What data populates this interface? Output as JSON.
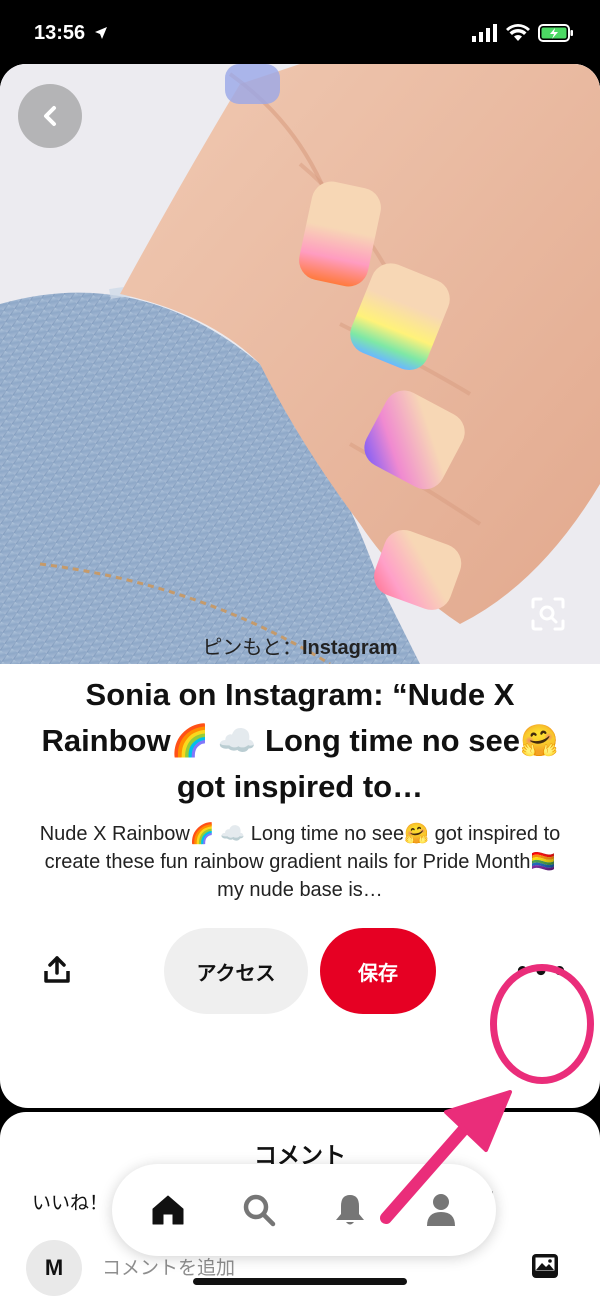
{
  "status_bar": {
    "time": "13:56",
    "icons": [
      "location-arrow-icon",
      "signal-icon",
      "wifi-icon",
      "battery-charging-icon"
    ]
  },
  "pin": {
    "source_prefix": "ピンもと：",
    "source_name": "Instagram",
    "title": "Sonia on Instagram: “Nude X Rainbow🌈 ☁️ Long time no see🤗 got inspired to…",
    "description": "Nude X Rainbow🌈 ☁️ Long time no see🤗 got inspired to create these fun rainbow gradient nails for Pride Month🏳️‍🌈 my nude base is…",
    "image_icon": "nail-photo"
  },
  "actions": {
    "share_icon": "share-icon",
    "visit_label": "アクセス",
    "save_label": "保存",
    "more_label": "•••"
  },
  "comments": {
    "title": "コメント",
    "like_text": "いいね！",
    "like_end": "!",
    "avatar_initial": "M",
    "input_placeholder": "コメントを追加"
  },
  "tabbar": {
    "items": [
      "home-icon",
      "search-icon",
      "bell-icon",
      "profile-icon"
    ]
  },
  "colors": {
    "accent_red": "#e60023",
    "annotation_pink": "#ea2d7a"
  }
}
